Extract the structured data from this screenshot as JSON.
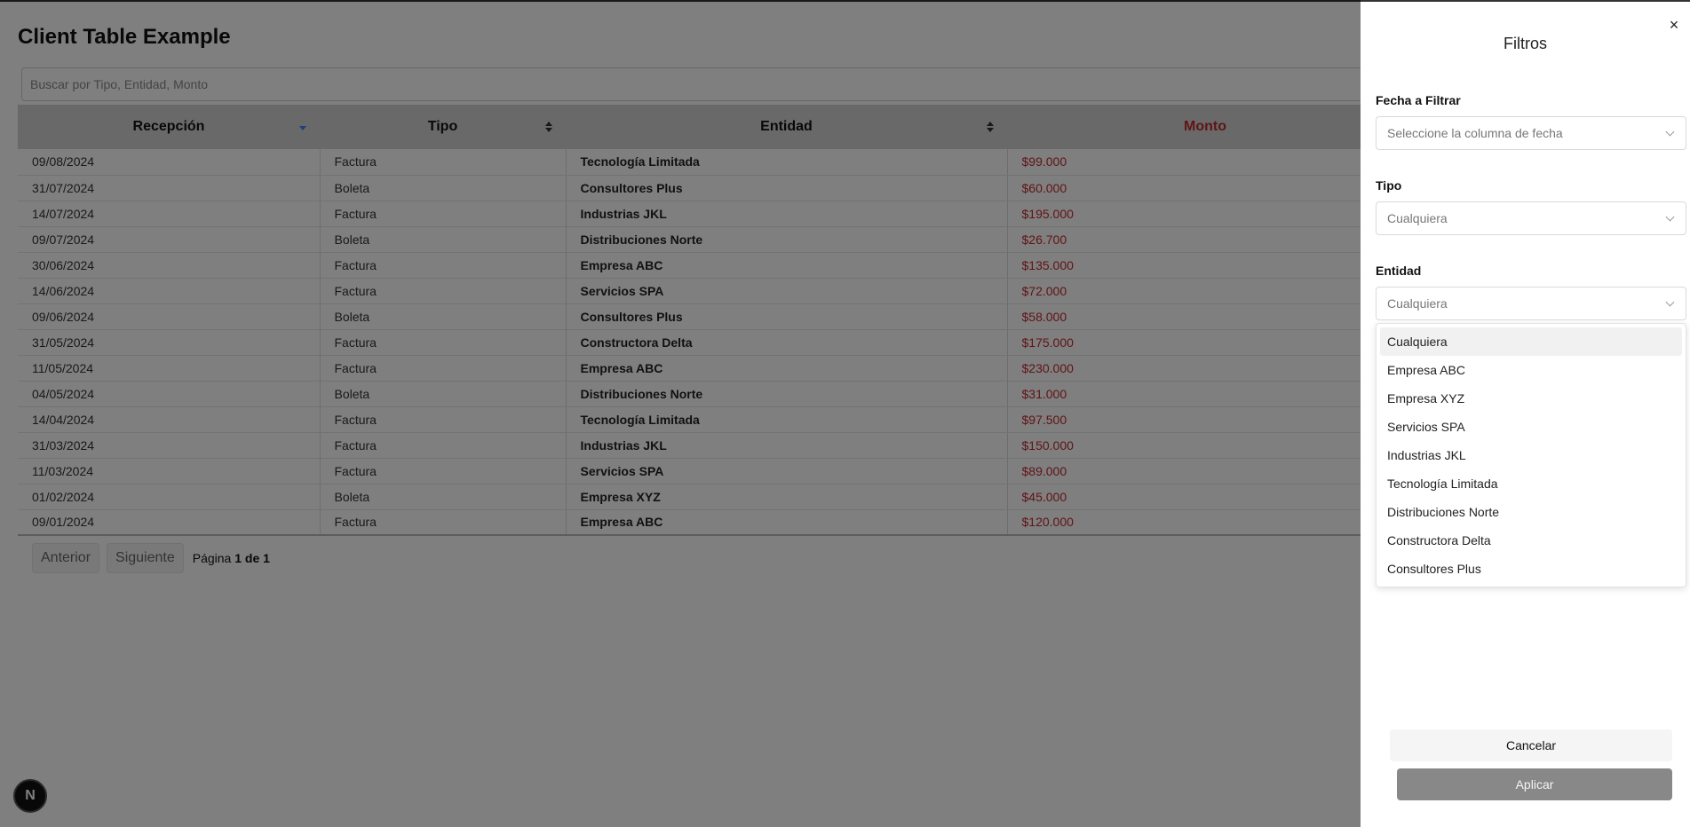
{
  "page": {
    "title": "Client Table Example"
  },
  "search": {
    "placeholder": "Buscar por Tipo, Entidad, Monto"
  },
  "table": {
    "headers": {
      "recepcion": "Recepción",
      "tipo": "Tipo",
      "entidad": "Entidad",
      "monto": "Monto"
    },
    "sort": {
      "column": "recepcion",
      "direction": "desc"
    },
    "rows": [
      {
        "recepcion": "09/08/2024",
        "tipo": "Factura",
        "entidad": "Tecnología Limitada",
        "monto": "$99.000"
      },
      {
        "recepcion": "31/07/2024",
        "tipo": "Boleta",
        "entidad": "Consultores Plus",
        "monto": "$60.000"
      },
      {
        "recepcion": "14/07/2024",
        "tipo": "Factura",
        "entidad": "Industrias JKL",
        "monto": "$195.000"
      },
      {
        "recepcion": "09/07/2024",
        "tipo": "Boleta",
        "entidad": "Distribuciones Norte",
        "monto": "$26.700"
      },
      {
        "recepcion": "30/06/2024",
        "tipo": "Factura",
        "entidad": "Empresa ABC",
        "monto": "$135.000"
      },
      {
        "recepcion": "14/06/2024",
        "tipo": "Factura",
        "entidad": "Servicios SPA",
        "monto": "$72.000"
      },
      {
        "recepcion": "09/06/2024",
        "tipo": "Boleta",
        "entidad": "Consultores Plus",
        "monto": "$58.000"
      },
      {
        "recepcion": "31/05/2024",
        "tipo": "Factura",
        "entidad": "Constructora Delta",
        "monto": "$175.000"
      },
      {
        "recepcion": "11/05/2024",
        "tipo": "Factura",
        "entidad": "Empresa ABC",
        "monto": "$230.000"
      },
      {
        "recepcion": "04/05/2024",
        "tipo": "Boleta",
        "entidad": "Distribuciones Norte",
        "monto": "$31.000"
      },
      {
        "recepcion": "14/04/2024",
        "tipo": "Factura",
        "entidad": "Tecnología Limitada",
        "monto": "$97.500"
      },
      {
        "recepcion": "31/03/2024",
        "tipo": "Factura",
        "entidad": "Industrias JKL",
        "monto": "$150.000"
      },
      {
        "recepcion": "11/03/2024",
        "tipo": "Factura",
        "entidad": "Servicios SPA",
        "monto": "$89.000"
      },
      {
        "recepcion": "01/02/2024",
        "tipo": "Boleta",
        "entidad": "Empresa XYZ",
        "monto": "$45.000"
      },
      {
        "recepcion": "09/01/2024",
        "tipo": "Factura",
        "entidad": "Empresa ABC",
        "monto": "$120.000"
      }
    ]
  },
  "pagination": {
    "prev_label": "Anterior",
    "next_label": "Siguiente",
    "page_label": "Página",
    "current": "1",
    "of_label": "de",
    "total": "1"
  },
  "badge": {
    "letter": "N"
  },
  "filters": {
    "title": "Filtros",
    "close_glyph": "×",
    "fecha": {
      "label": "Fecha a Filtrar",
      "placeholder": "Seleccione la columna de fecha"
    },
    "tipo": {
      "label": "Tipo",
      "value": "Cualquiera"
    },
    "entidad": {
      "label": "Entidad",
      "value": "Cualquiera",
      "options": [
        "Cualquiera",
        "Empresa ABC",
        "Empresa XYZ",
        "Servicios SPA",
        "Industrias JKL",
        "Tecnología Limitada",
        "Distribuciones Norte",
        "Constructora Delta",
        "Consultores Plus"
      ]
    },
    "cancel_label": "Cancelar",
    "apply_label": "Aplicar"
  },
  "colors": {
    "accent_red": "#c0282d",
    "sort_blue": "#3b82f6",
    "overlay": "rgba(0,0,0,0.5)",
    "apply_bg": "#888888"
  }
}
